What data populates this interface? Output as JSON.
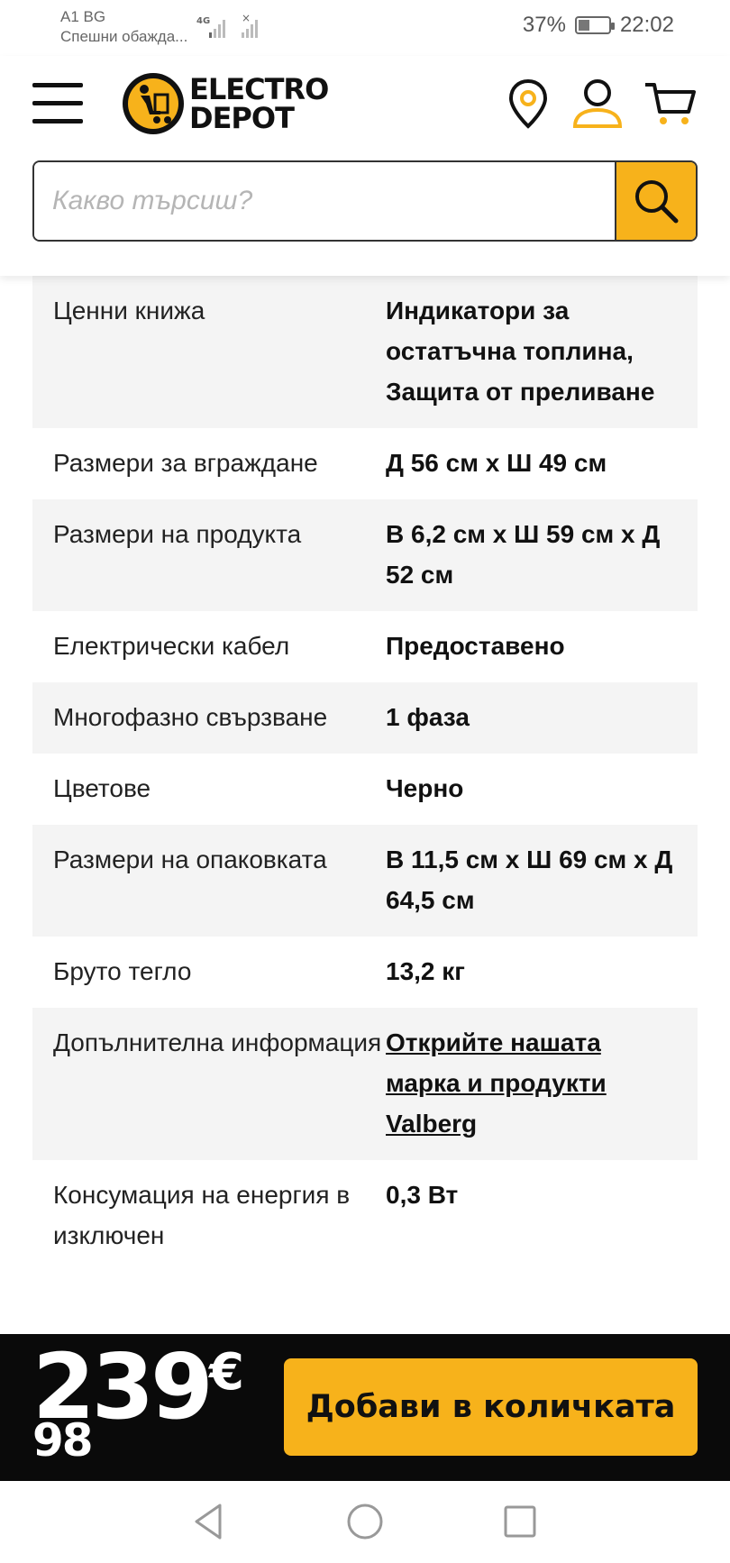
{
  "status_bar": {
    "carrier": "A1 BG",
    "carrier_sub": "Спешни обажда...",
    "network": "4G",
    "battery": "37%",
    "battery_level": 0.37,
    "time": "22:02"
  },
  "header": {
    "logo_line1": "ELECTRO",
    "logo_line2": "DEPOT",
    "icons": [
      "menu-icon",
      "location-pin-icon",
      "user-icon",
      "cart-icon"
    ],
    "search": {
      "placeholder": "Какво търсиш?"
    },
    "accent_color": "#f7b21b"
  },
  "specs": [
    {
      "label": "Ценни книжа",
      "value": "Индикатори за остатъчна топлина, Защита от преливане"
    },
    {
      "label": "Размери за вграждане",
      "value": "Д 56 см x Ш 49 см"
    },
    {
      "label": "Размери на продукта",
      "value": "В 6,2 см x Ш 59 см x Д 52 см"
    },
    {
      "label": "Електрически кабел",
      "value": "Предоставено"
    },
    {
      "label": "Многофазно свързване",
      "value": "1 фаза"
    },
    {
      "label": "Цветове",
      "value": "Черно"
    },
    {
      "label": "Размери на опаковката",
      "value": "В 11,5 см x Ш 69 см x Д 64,5 см"
    },
    {
      "label": "Бруто тегло",
      "value": "13,2 кг"
    },
    {
      "label": "Допълнителна информация",
      "value": "Открийте нашата марка и продукти Valberg"
    },
    {
      "label": "Консумация на енергия в изключен",
      "value": "0,3 Вт"
    }
  ],
  "buy_bar": {
    "price_int": "239",
    "price_cents": "98",
    "currency": "€",
    "add_to_cart_label": "Добави в количката"
  }
}
